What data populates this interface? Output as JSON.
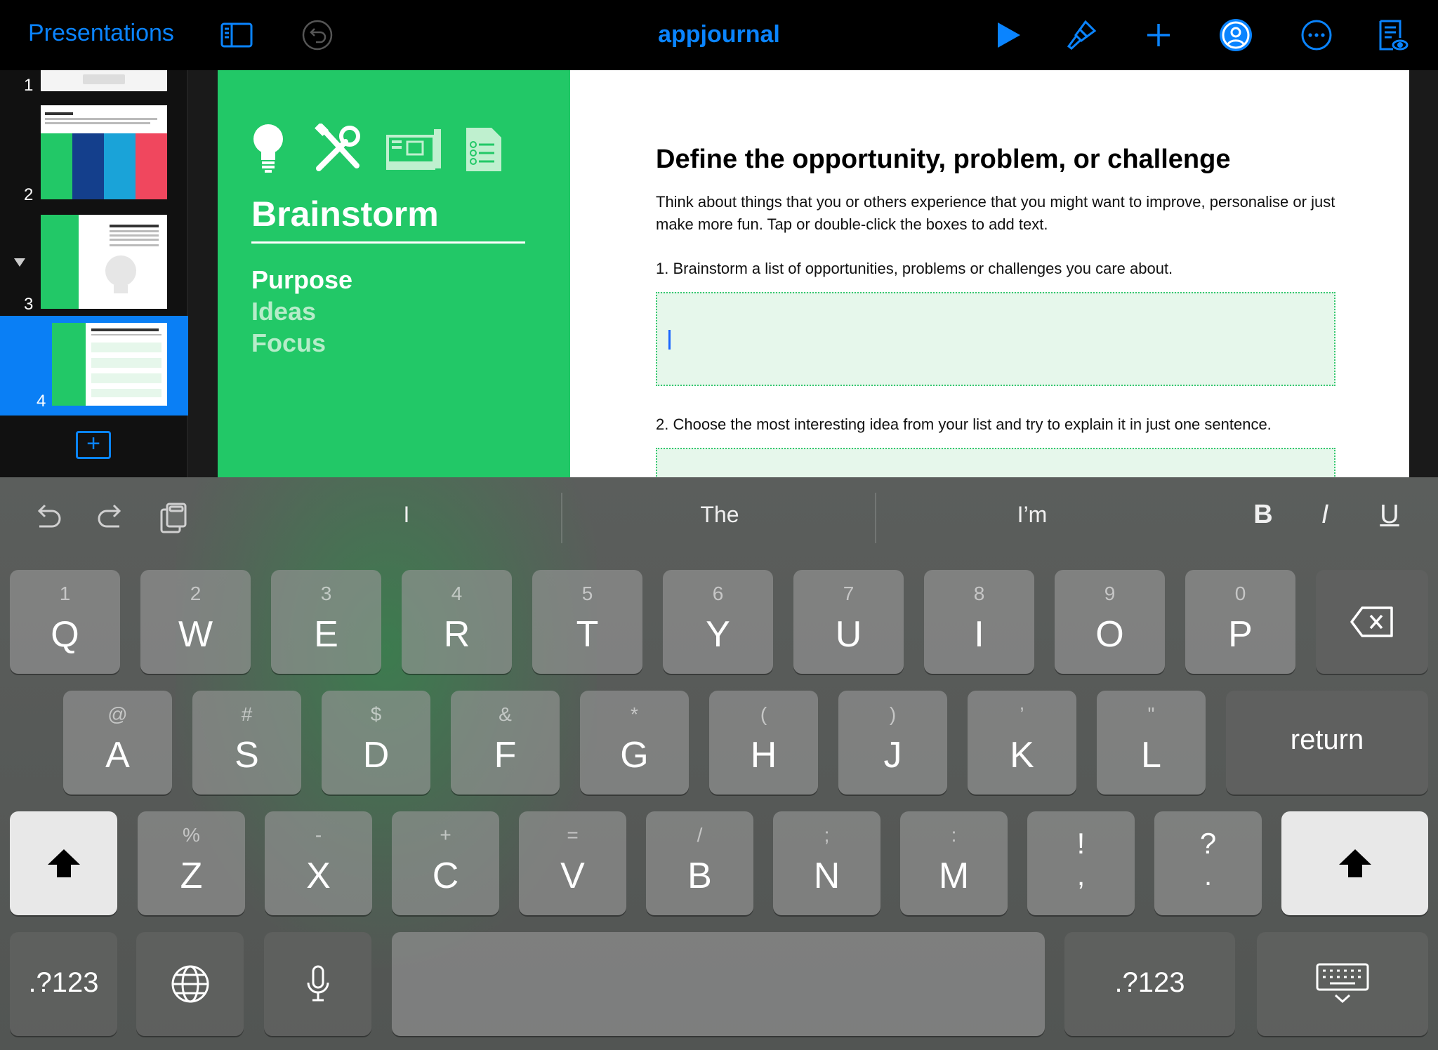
{
  "toolbar": {
    "back_label": "Presentations",
    "title": "appjournal",
    "accent": "#0a84ff"
  },
  "sidebar": {
    "slides": [
      {
        "number": "1"
      },
      {
        "number": "2"
      },
      {
        "number": "3"
      },
      {
        "number": "4",
        "selected": true
      }
    ],
    "add_slide_label": "+"
  },
  "slide": {
    "heading": "Brainstorm",
    "menu": [
      "Purpose",
      "Ideas",
      "Focus"
    ],
    "title": "Define the opportunity, problem, or challenge",
    "intro": "Think about things that you or others experience that you might want to improve, personalise or just make more fun. Tap or double-click the boxes to add text.",
    "steps": [
      "1. Brainstorm a list of opportunities, problems or challenges you care about.",
      "2. Choose the most interesting idea from your list and try to explain it in just one sentence."
    ],
    "colors": {
      "green": "#22c867",
      "box": "#e6f7eb"
    }
  },
  "keyboard": {
    "suggestions": [
      "I",
      "The",
      "I’m"
    ],
    "format": {
      "bold": "B",
      "italic": "I",
      "underline": "U"
    },
    "row1": [
      {
        "alt": "1",
        "main": "Q"
      },
      {
        "alt": "2",
        "main": "W"
      },
      {
        "alt": "3",
        "main": "E"
      },
      {
        "alt": "4",
        "main": "R"
      },
      {
        "alt": "5",
        "main": "T"
      },
      {
        "alt": "6",
        "main": "Y"
      },
      {
        "alt": "7",
        "main": "U"
      },
      {
        "alt": "8",
        "main": "I"
      },
      {
        "alt": "9",
        "main": "O"
      },
      {
        "alt": "0",
        "main": "P"
      }
    ],
    "row2": [
      {
        "alt": "@",
        "main": "A"
      },
      {
        "alt": "#",
        "main": "S"
      },
      {
        "alt": "$",
        "main": "D"
      },
      {
        "alt": "&",
        "main": "F"
      },
      {
        "alt": "*",
        "main": "G"
      },
      {
        "alt": "(",
        "main": "H"
      },
      {
        "alt": ")",
        "main": "J"
      },
      {
        "alt": "’",
        "main": "K"
      },
      {
        "alt": "\"",
        "main": "L"
      }
    ],
    "row3": [
      {
        "alt": "%",
        "main": "Z"
      },
      {
        "alt": "-",
        "main": "X"
      },
      {
        "alt": "+",
        "main": "C"
      },
      {
        "alt": "=",
        "main": "V"
      },
      {
        "alt": "/",
        "main": "B"
      },
      {
        "alt": ";",
        "main": "N"
      },
      {
        "alt": ":",
        "main": "M"
      },
      {
        "alt": "!",
        "main": ","
      },
      {
        "alt": "?",
        "main": "."
      }
    ],
    "return_label": "return",
    "numbers_label": ".?123"
  }
}
